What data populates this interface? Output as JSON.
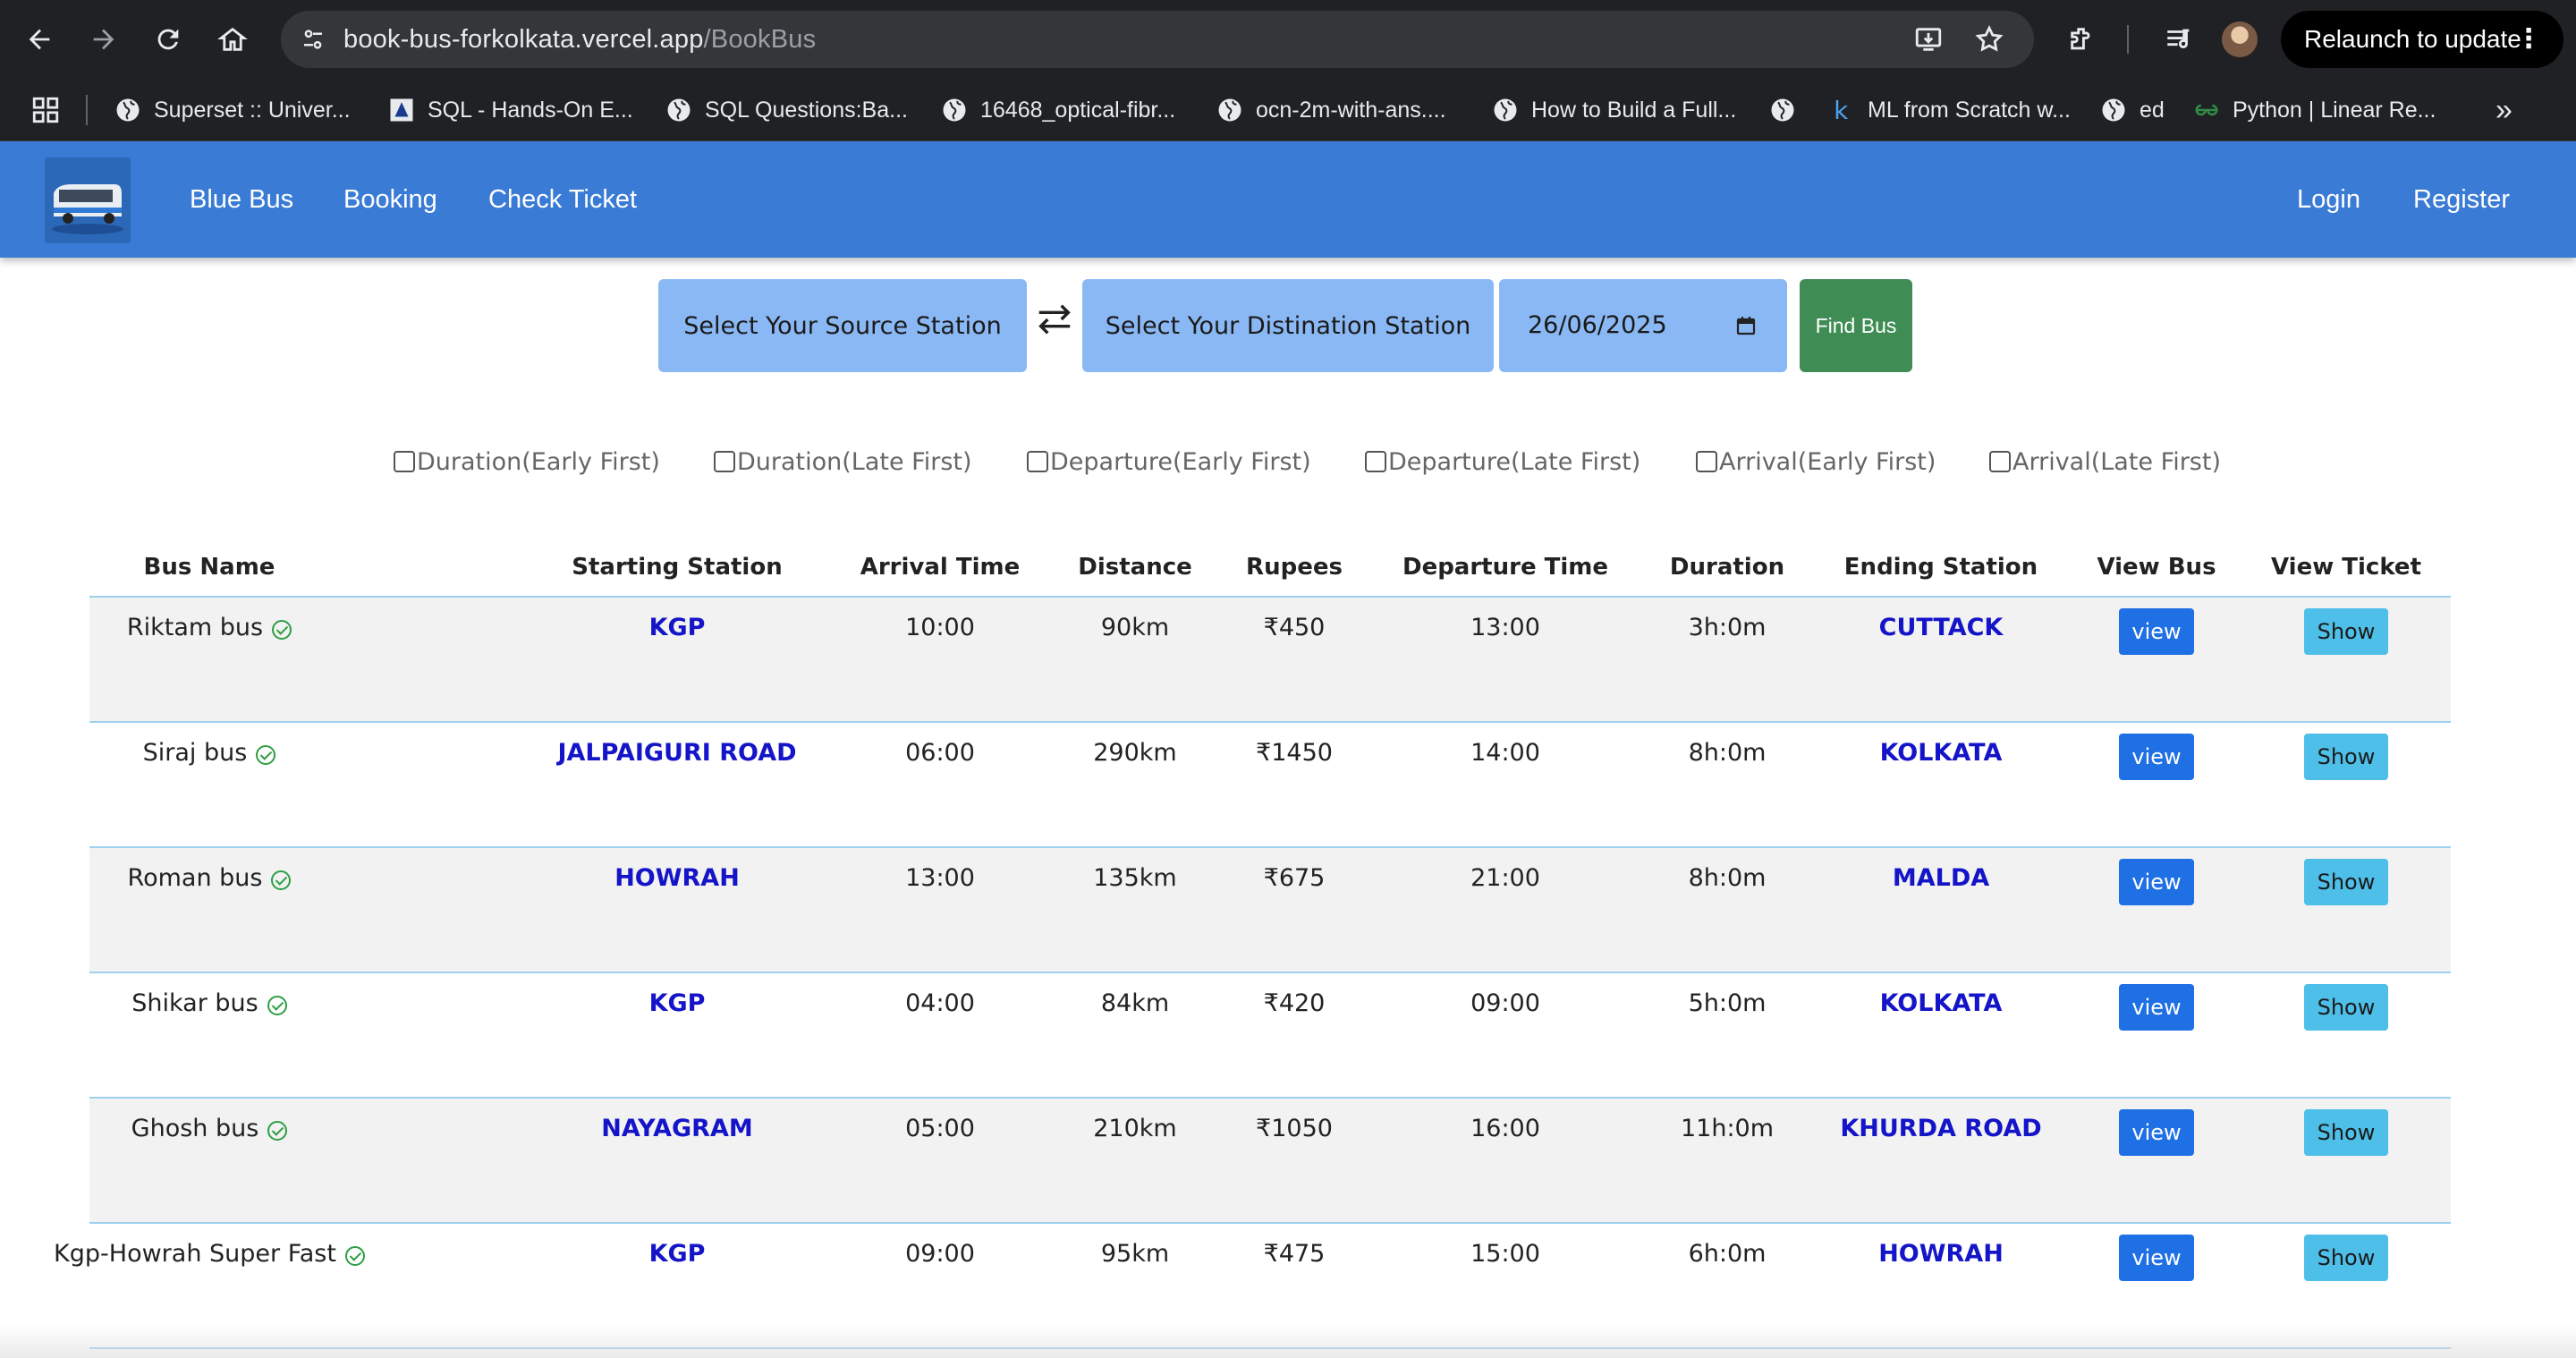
{
  "browser": {
    "url_host": "book-bus-forkolkata.vercel.app",
    "url_path": "/BookBus",
    "relaunch_label": "Relaunch to update",
    "bookmarks": [
      {
        "label": "Superset :: Univer...",
        "icon": "globe-icon"
      },
      {
        "label": "SQL - Hands-On E...",
        "icon": "site-icon"
      },
      {
        "label": "SQL Questions:Ba...",
        "icon": "globe-icon"
      },
      {
        "label": "16468_optical-fibr...",
        "icon": "globe-icon"
      },
      {
        "label": "ocn-2m-with-ans....",
        "icon": "globe-icon"
      },
      {
        "label": "How to Build a Full...",
        "icon": "globe-icon"
      },
      {
        "label": "",
        "icon": "globe-icon"
      },
      {
        "label": "ML from Scratch w...",
        "icon": "k-icon"
      },
      {
        "label": "ed",
        "icon": "globe-icon"
      },
      {
        "label": "Python | Linear Re...",
        "icon": "gfg-icon"
      }
    ]
  },
  "navbar": {
    "brand": "Blue Bus",
    "links": [
      "Booking",
      "Check Ticket"
    ],
    "login": "Login",
    "register": "Register"
  },
  "search": {
    "source": "Select Your Source Station",
    "destination": "Select Your Distination Station",
    "date": "26/06/2025",
    "find_label": "Find Bus"
  },
  "filters": [
    "Duration(Early First)",
    "Duration(Late First)",
    "Departure(Early First)",
    "Departure(Late First)",
    "Arrival(Early First)",
    "Arrival(Late First)"
  ],
  "table": {
    "headers": [
      "Bus Name",
      "Starting Station",
      "Arrival Time",
      "Distance",
      "Rupees",
      "Departure Time",
      "Duration",
      "Ending Station",
      "View Bus",
      "View Ticket"
    ],
    "rows": [
      {
        "bus": "Riktam bus",
        "start": "KGP",
        "arrival": "10:00",
        "distance": "90km",
        "rupees": "₹450",
        "departure": "13:00",
        "duration": "3h:0m",
        "end": "CUTTACK",
        "view": "view",
        "show": "Show"
      },
      {
        "bus": "Siraj bus",
        "start": "JALPAIGURI ROAD",
        "arrival": "06:00",
        "distance": "290km",
        "rupees": "₹1450",
        "departure": "14:00",
        "duration": "8h:0m",
        "end": "KOLKATA",
        "view": "view",
        "show": "Show"
      },
      {
        "bus": "Roman bus",
        "start": "HOWRAH",
        "arrival": "13:00",
        "distance": "135km",
        "rupees": "₹675",
        "departure": "21:00",
        "duration": "8h:0m",
        "end": "MALDA",
        "view": "view",
        "show": "Show"
      },
      {
        "bus": "Shikar bus",
        "start": "KGP",
        "arrival": "04:00",
        "distance": "84km",
        "rupees": "₹420",
        "departure": "09:00",
        "duration": "5h:0m",
        "end": "KOLKATA",
        "view": "view",
        "show": "Show"
      },
      {
        "bus": "Ghosh bus",
        "start": "NAYAGRAM",
        "arrival": "05:00",
        "distance": "210km",
        "rupees": "₹1050",
        "departure": "16:00",
        "duration": "11h:0m",
        "end": "KHURDA ROAD",
        "view": "view",
        "show": "Show"
      },
      {
        "bus": "Kgp-Howrah Super Fast",
        "start": "KGP",
        "arrival": "09:00",
        "distance": "95km",
        "rupees": "₹475",
        "departure": "15:00",
        "duration": "6h:0m",
        "end": "HOWRAH",
        "view": "view",
        "show": "Show"
      }
    ]
  },
  "colors": {
    "navbar": "#3a7bd5",
    "search_box": "#8ab8f4",
    "find_button": "#3f8d54",
    "station_text": "#1414c8",
    "view_button": "#1f6fe5",
    "show_button": "#4dbfe8",
    "verified": "#2e9e44"
  }
}
